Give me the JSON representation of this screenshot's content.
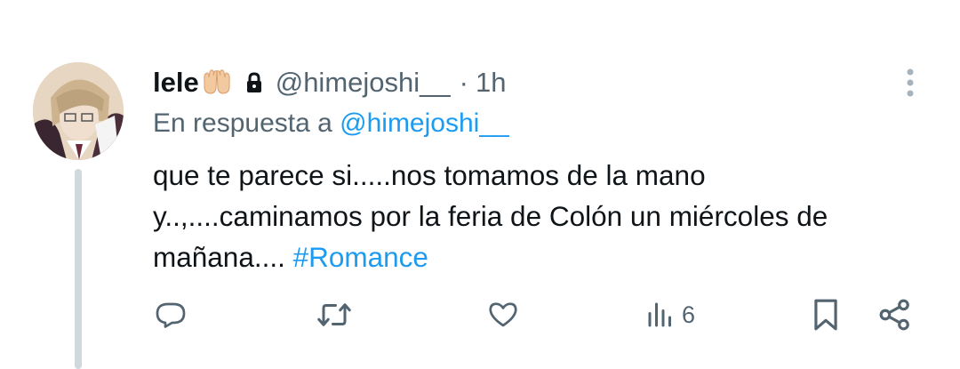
{
  "tweet": {
    "author_name": "lele",
    "author_emoji": "🤲",
    "handle": "@himejoshi__",
    "separator": "·",
    "time": "1h",
    "reply_prefix": "En respuesta a",
    "reply_to": "@himejoshi__",
    "text_lines": [
      "que te parece si.....nos tomamos de la mano",
      "y..,....caminamos por la feria de Colón un miércoles de",
      "mañana...."
    ],
    "hashtag": "#Romance",
    "views": "6"
  },
  "icons": {
    "avatar": "avatar-image",
    "lock": "lock-icon",
    "more": "more-vertical-icon",
    "reply": "reply-icon",
    "retweet": "retweet-icon",
    "like": "heart-icon",
    "views": "views-icon",
    "bookmark": "bookmark-icon",
    "share": "share-icon"
  },
  "colors": {
    "text": "#0f1419",
    "secondary": "#536471",
    "link": "#1d9bf0",
    "thread_line": "#cfd9de"
  }
}
